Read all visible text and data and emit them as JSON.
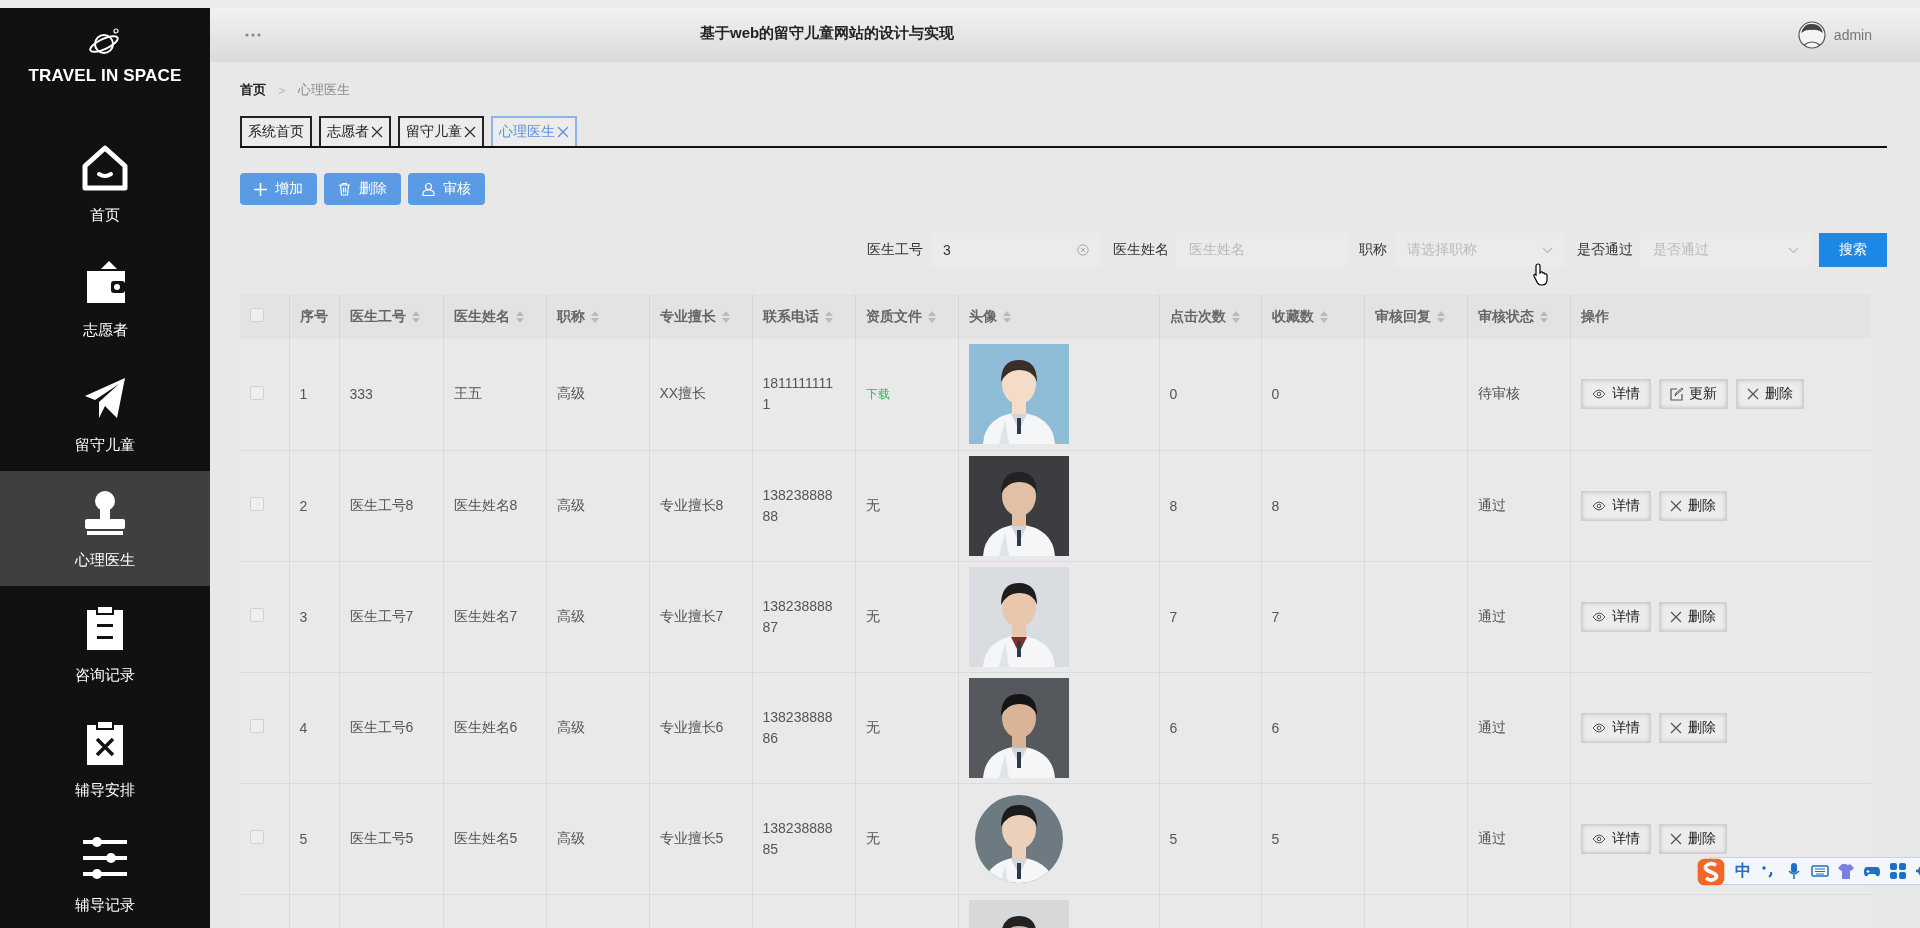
{
  "sidebar": {
    "logo": "TRAVEL IN SPACE",
    "items": [
      {
        "label": "首页",
        "selected": false
      },
      {
        "label": "志愿者",
        "selected": false
      },
      {
        "label": "留守儿童",
        "selected": false
      },
      {
        "label": "心理医生",
        "selected": true
      },
      {
        "label": "咨询记录",
        "selected": false
      },
      {
        "label": "辅导安排",
        "selected": false
      },
      {
        "label": "辅导记录",
        "selected": false
      }
    ]
  },
  "header": {
    "title": "基于web的留守儿童网站的设计与实现",
    "user": "admin"
  },
  "breadcrumb": {
    "items": [
      "首页",
      "心理医生"
    ],
    "separator": ">"
  },
  "tabs": [
    {
      "label": "系统首页",
      "closable": false,
      "selected": false
    },
    {
      "label": "志愿者",
      "closable": true,
      "selected": false
    },
    {
      "label": "留守儿童",
      "closable": true,
      "selected": false
    },
    {
      "label": "心理医生",
      "closable": true,
      "selected": true
    }
  ],
  "actions": [
    {
      "label": "增加",
      "kind": "add"
    },
    {
      "label": "删除",
      "kind": "delete"
    },
    {
      "label": "审核",
      "kind": "audit"
    }
  ],
  "search": {
    "fields": [
      {
        "label": "医生工号",
        "kind": "input",
        "value": "3",
        "clearable": true
      },
      {
        "label": "医生姓名",
        "kind": "input",
        "placeholder": "医生姓名"
      },
      {
        "label": "职称",
        "kind": "select",
        "placeholder": "请选择职称"
      },
      {
        "label": "是否通过",
        "kind": "select",
        "placeholder": "是否通过"
      }
    ],
    "button": "搜索"
  },
  "table": {
    "all_checked": false,
    "columns": [
      {
        "label": "序号",
        "sortable": false
      },
      {
        "label": "医生工号",
        "sortable": true
      },
      {
        "label": "医生姓名",
        "sortable": true
      },
      {
        "label": "职称",
        "sortable": true
      },
      {
        "label": "专业擅长",
        "sortable": true
      },
      {
        "label": "联系电话",
        "sortable": true
      },
      {
        "label": "资质文件",
        "sortable": true
      },
      {
        "label": "头像",
        "sortable": true
      },
      {
        "label": "点击次数",
        "sortable": true
      },
      {
        "label": "收藏数",
        "sortable": true
      },
      {
        "label": "审核回复",
        "sortable": true
      },
      {
        "label": "审核状态",
        "sortable": true
      },
      {
        "label": "操作",
        "sortable": false
      }
    ],
    "rows": [
      {
        "checked": false,
        "index": "1",
        "doctor_id": "333",
        "doctor_name": "王五",
        "title": "高级",
        "specialty": "XX擅长",
        "phone": "18111111111",
        "certificate": {
          "kind": "link",
          "text": "下载"
        },
        "avatar": {
          "kind": "picture"
        },
        "clicks": "0",
        "favorites": "0",
        "status": "待审核",
        "actions": [
          {
            "label": "详情",
            "kind": "view"
          },
          {
            "label": "更新",
            "kind": "edit"
          },
          {
            "label": "删除",
            "kind": "delete"
          }
        ]
      },
      {
        "checked": false,
        "index": "2",
        "doctor_id": "医生工号8",
        "doctor_name": "医生姓名8",
        "title": "高级",
        "specialty": "专业擅长8",
        "phone": "13823888888",
        "certificate": {
          "kind": "text",
          "text": "无"
        },
        "avatar": {
          "kind": "picture"
        },
        "clicks": "8",
        "favorites": "8",
        "status": "通过",
        "actions": [
          {
            "label": "详情",
            "kind": "view"
          },
          {
            "label": "删除",
            "kind": "delete"
          }
        ]
      },
      {
        "checked": false,
        "index": "3",
        "doctor_id": "医生工号7",
        "doctor_name": "医生姓名7",
        "title": "高级",
        "specialty": "专业擅长7",
        "phone": "13823888887",
        "certificate": {
          "kind": "text",
          "text": "无"
        },
        "avatar": {
          "kind": "picture"
        },
        "clicks": "7",
        "favorites": "7",
        "status": "通过",
        "actions": [
          {
            "label": "详情",
            "kind": "view"
          },
          {
            "label": "删除",
            "kind": "delete"
          }
        ]
      },
      {
        "checked": false,
        "index": "4",
        "doctor_id": "医生工号6",
        "doctor_name": "医生姓名6",
        "title": "高级",
        "specialty": "专业擅长6",
        "phone": "13823888886",
        "certificate": {
          "kind": "text",
          "text": "无"
        },
        "avatar": {
          "kind": "picture"
        },
        "clicks": "6",
        "favorites": "6",
        "status": "通过",
        "actions": [
          {
            "label": "详情",
            "kind": "view"
          },
          {
            "label": "删除",
            "kind": "delete"
          }
        ]
      },
      {
        "checked": false,
        "index": "5",
        "doctor_id": "医生工号5",
        "doctor_name": "医生姓名5",
        "title": "高级",
        "specialty": "专业擅长5",
        "phone": "13823888885",
        "certificate": {
          "kind": "text",
          "text": "无"
        },
        "avatar": {
          "kind": "picture"
        },
        "clicks": "5",
        "favorites": "5",
        "status": "通过",
        "actions": [
          {
            "label": "详情",
            "kind": "view"
          },
          {
            "label": "删除",
            "kind": "delete"
          }
        ]
      },
      {
        "avatar": {
          "kind": "picture"
        }
      }
    ]
  },
  "ime_bar": {
    "mode": "中"
  }
}
